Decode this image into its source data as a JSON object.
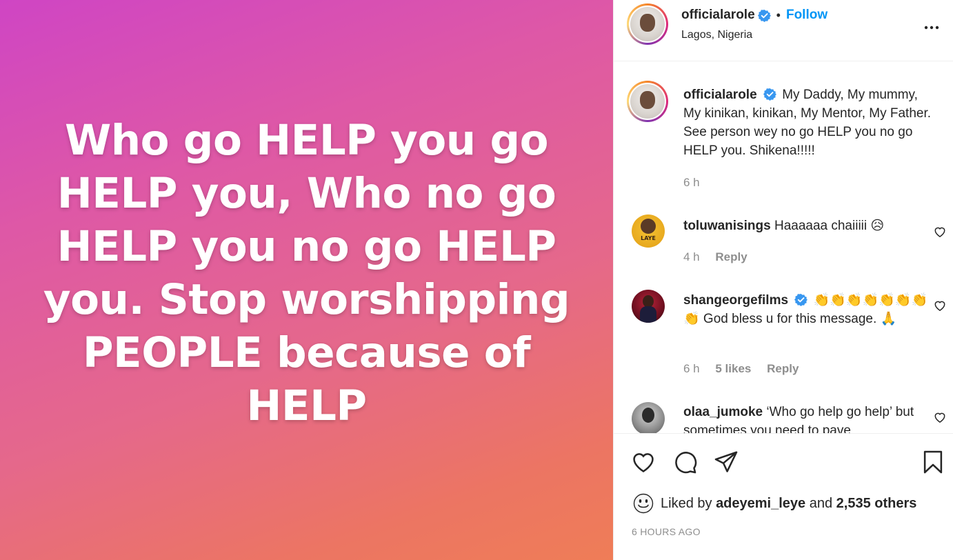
{
  "media": {
    "text": "Who go HELP you go HELP you, Who no go HELP you no go HELP you. Stop worshipping PEOPLE because of HELP"
  },
  "header": {
    "username": "officialarole",
    "separator": "•",
    "follow_label": "Follow",
    "location": "Lagos, Nigeria",
    "more_icon": "more-horizontal-icon"
  },
  "caption": {
    "username": "officialarole",
    "text": "My Daddy, My mummy, My kinikan, kinikan, My Mentor, My Father. See person wey no go HELP you no go HELP you. Shikena!!!!!",
    "time": "6 h"
  },
  "comments": [
    {
      "username": "toluwanisings",
      "text": "Haaaaaa chaiiiii 😥",
      "time": "4 h",
      "likes": "",
      "reply_label": "Reply",
      "avatar_text": "LAYE"
    },
    {
      "username": "shangeorgefilms",
      "text": "👏👏👏👏👏👏👏👏 God bless u for this message. 🙏",
      "time": "6 h",
      "likes": "5 likes",
      "reply_label": "Reply"
    },
    {
      "username": "olaa_jumoke",
      "text": "‘Who go help go help’ but sometimes you need to pave"
    }
  ],
  "actions": {
    "liked_by_prefix": "Liked by",
    "liked_by_user": "adeyemi_leye",
    "and_label": "and",
    "others_label": "2,535 others",
    "time_ago": "6 HOURS AGO"
  },
  "colors": {
    "accent": "#0095f6",
    "verified": "#3897f0",
    "muted": "#8e8e8e"
  }
}
